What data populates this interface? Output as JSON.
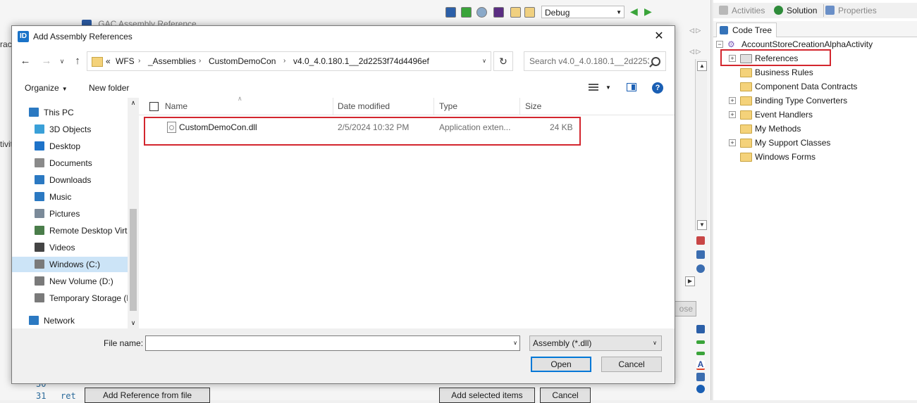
{
  "ide": {
    "debug_config": "Debug",
    "gac_window_title": "GAC Assembly Reference",
    "left_text_1": "ract",
    "left_text_2": "tivit",
    "code_line_30": "30",
    "code_line_31": "31",
    "code_ret": "ret",
    "bg_close_label": "ose",
    "add_reference_from_file": "Add Reference from file",
    "add_selected_items": "Add selected items",
    "bg_cancel": "Cancel"
  },
  "right_panel": {
    "tabs": [
      {
        "label": "Activities",
        "icon": "activities-icon",
        "color": "#b8b8b8"
      },
      {
        "label": "Solution",
        "icon": "solution-icon",
        "color": "#2e8b3a"
      },
      {
        "label": "Properties",
        "icon": "properties-icon",
        "color": "#6a8fc7"
      }
    ],
    "code_tree_tab": "Code Tree",
    "tree": {
      "root": "AccountStoreCreationAlphaActivity",
      "children": [
        {
          "label": "References",
          "expandable": true
        },
        {
          "label": "Business Rules",
          "expandable": false
        },
        {
          "label": "Component Data Contracts",
          "expandable": false
        },
        {
          "label": "Binding Type Converters",
          "expandable": true
        },
        {
          "label": "Event Handlers",
          "expandable": true
        },
        {
          "label": "My Methods",
          "expandable": false
        },
        {
          "label": "My Support Classes",
          "expandable": true
        },
        {
          "label": "Windows Forms",
          "expandable": false
        }
      ]
    }
  },
  "dialog": {
    "app_icon": "ID",
    "title": "Add Assembly References",
    "close_glyph": "✕",
    "breadcrumb": {
      "prefix": "«",
      "items": [
        "WFS",
        "_Assemblies",
        "CustomDemoCon",
        "v4.0_4.0.180.1__2d2253f74d4496ef"
      ]
    },
    "search_placeholder": "Search v4.0_4.0.180.1__2d2253...",
    "organize": "Organize",
    "new_folder": "New folder",
    "help": "?",
    "nav_items": [
      {
        "label": "This PC",
        "icon": "this-pc-icon",
        "color": "#2b79c2",
        "level": 1
      },
      {
        "label": "3D Objects",
        "icon": "3d-objects-icon",
        "color": "#3aa0d8",
        "level": 2
      },
      {
        "label": "Desktop",
        "icon": "desktop-icon",
        "color": "#1e73c9",
        "level": 2
      },
      {
        "label": "Documents",
        "icon": "documents-icon",
        "color": "#8a8a8a",
        "level": 2
      },
      {
        "label": "Downloads",
        "icon": "downloads-icon",
        "color": "#2b79c2",
        "level": 2
      },
      {
        "label": "Music",
        "icon": "music-icon",
        "color": "#2b79c2",
        "level": 2
      },
      {
        "label": "Pictures",
        "icon": "pictures-icon",
        "color": "#7b8a99",
        "level": 2
      },
      {
        "label": "Remote Desktop Virtu",
        "icon": "remote-desktop-icon",
        "color": "#4a7d4a",
        "level": 2
      },
      {
        "label": "Videos",
        "icon": "videos-icon",
        "color": "#444444",
        "level": 2
      },
      {
        "label": "Windows (C:)",
        "icon": "drive-c-icon",
        "color": "#7a7a7a",
        "level": 2,
        "selected": true
      },
      {
        "label": "New Volume (D:)",
        "icon": "drive-d-icon",
        "color": "#7a7a7a",
        "level": 2
      },
      {
        "label": "Temporary Storage (E",
        "icon": "drive-e-icon",
        "color": "#7a7a7a",
        "level": 2
      },
      {
        "label": "Network",
        "icon": "network-icon",
        "color": "#2b79c2",
        "level": 1
      }
    ],
    "columns": [
      "Name",
      "Date modified",
      "Type",
      "Size"
    ],
    "files": [
      {
        "name": "CustomDemoCon.dll",
        "date_modified": "2/5/2024 10:32 PM",
        "type": "Application exten...",
        "size": "24 KB"
      }
    ],
    "file_name_label": "File name:",
    "file_name_value": "",
    "file_type_filter": "Assembly (*.dll)",
    "open_button": "Open",
    "cancel_button": "Cancel"
  },
  "colors": {
    "highlight_red": "#d3262e",
    "accent_blue": "#0078d7",
    "selected_bg": "#cce4f7"
  }
}
